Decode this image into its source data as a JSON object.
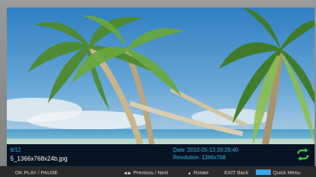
{
  "viewer": {
    "counter": "6/12",
    "filename": "5_1366x768x24b.jpg",
    "date_label": "Date",
    "date_value": "2010-05-13 20:28:40",
    "resolution_label": "Resolution",
    "resolution_value": "1366x768",
    "repeat_icon": "repeat-arrows-icon"
  },
  "help_bar": {
    "ok_hint": "OK PLAY / PAUSE",
    "nav_arrows": "◀ ▶",
    "nav_hint": "Previous / Next",
    "rotate_arrows": "▲",
    "rotate_hint": "Rotate",
    "exit_hint": "EXIT Back",
    "quick_hint": "Quick Menu"
  },
  "colors": {
    "info_text": "#3ab0e6",
    "quick_key": "#3aa6e6",
    "repeat_icon": "#3ecc3e"
  }
}
